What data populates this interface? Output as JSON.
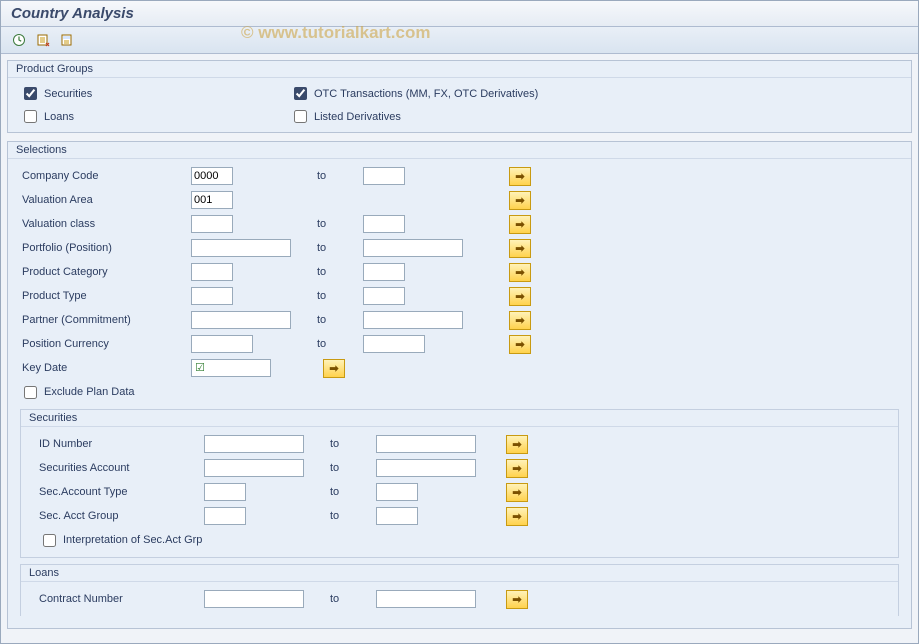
{
  "title": "Country Analysis",
  "watermark": "© www.tutorialkart.com",
  "labels": {
    "to": "to"
  },
  "product_groups": {
    "title": "Product Groups",
    "securities": {
      "label": "Securities",
      "checked": true
    },
    "otc": {
      "label": "OTC Transactions (MM, FX, OTC Derivatives)",
      "checked": true
    },
    "loans": {
      "label": "Loans",
      "checked": false
    },
    "listed": {
      "label": "Listed Derivatives",
      "checked": false
    }
  },
  "selections": {
    "title": "Selections",
    "company_code": {
      "label": "Company Code",
      "from": "0000",
      "to": ""
    },
    "valuation_area": {
      "label": "Valuation Area",
      "from": "001"
    },
    "valuation_class": {
      "label": "Valuation class",
      "from": "",
      "to": ""
    },
    "portfolio": {
      "label": "Portfolio (Position)",
      "from": "",
      "to": ""
    },
    "product_cat": {
      "label": "Product Category",
      "from": "",
      "to": ""
    },
    "product_type": {
      "label": "Product Type",
      "from": "",
      "to": ""
    },
    "partner": {
      "label": "Partner (Commitment)",
      "from": "",
      "to": ""
    },
    "pos_currency": {
      "label": "Position Currency",
      "from": "",
      "to": ""
    },
    "key_date": {
      "label": "Key Date",
      "value": ""
    },
    "exclude_plan": {
      "label": "Exclude Plan Data",
      "checked": false
    },
    "securities": {
      "title": "Securities",
      "id_number": {
        "label": "ID Number",
        "from": "",
        "to": ""
      },
      "sec_acct": {
        "label": "Securities Account",
        "from": "",
        "to": ""
      },
      "acct_type": {
        "label": "Sec.Account Type",
        "from": "",
        "to": ""
      },
      "acct_group": {
        "label": "Sec. Acct Group",
        "from": "",
        "to": ""
      },
      "interp": {
        "label": "Interpretation of Sec.Act Grp",
        "checked": false
      }
    },
    "loans": {
      "title": "Loans",
      "contract_number": {
        "label": "Contract Number",
        "from": "",
        "to": ""
      }
    }
  }
}
